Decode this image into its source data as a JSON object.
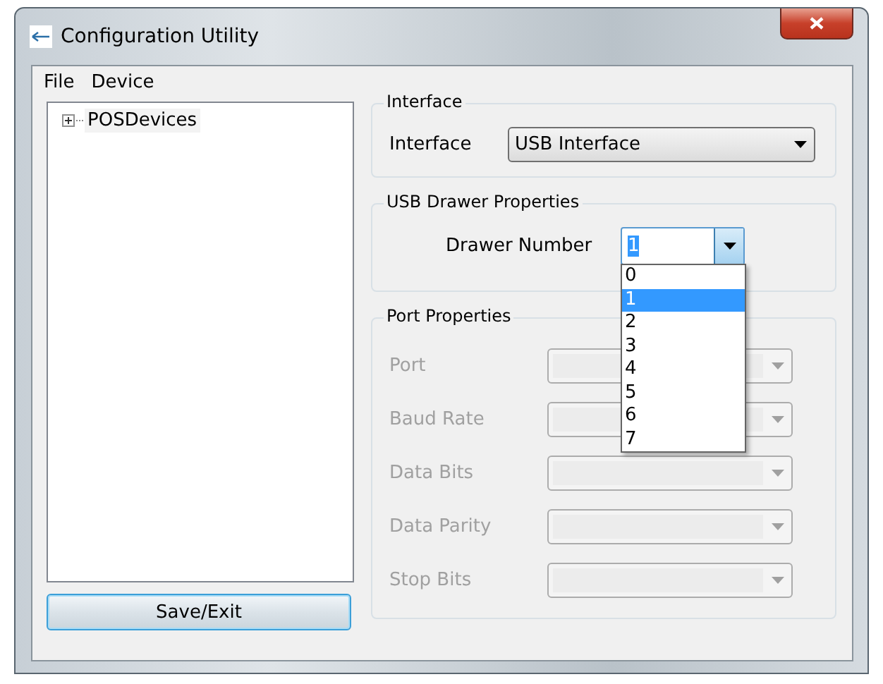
{
  "window": {
    "title": "Configuration Utility"
  },
  "menu": [
    {
      "label": "File"
    },
    {
      "label": "Device"
    }
  ],
  "tree": [
    {
      "label": "POSDevices",
      "expanded": false
    }
  ],
  "save_button": "Save/Exit",
  "interface_group": {
    "title": "Interface",
    "label": "Interface",
    "value": "USB Interface"
  },
  "usb_group": {
    "title": "USB Drawer Properties",
    "label": "Drawer Number",
    "value": "1",
    "open": true,
    "options": [
      {
        "label": "0",
        "selected": false
      },
      {
        "label": "1",
        "selected": true
      },
      {
        "label": "2",
        "selected": false
      },
      {
        "label": "3",
        "selected": false
      },
      {
        "label": "4",
        "selected": false
      },
      {
        "label": "5",
        "selected": false
      },
      {
        "label": "6",
        "selected": false
      },
      {
        "label": "7",
        "selected": false
      }
    ]
  },
  "port_group": {
    "title": "Port Properties",
    "fields": [
      {
        "label": "Port",
        "disabled": true
      },
      {
        "label": "Baud Rate",
        "disabled": true
      },
      {
        "label": "Data Bits",
        "disabled": true
      },
      {
        "label": "Data Parity",
        "disabled": true
      },
      {
        "label": "Stop Bits",
        "disabled": true
      }
    ]
  }
}
